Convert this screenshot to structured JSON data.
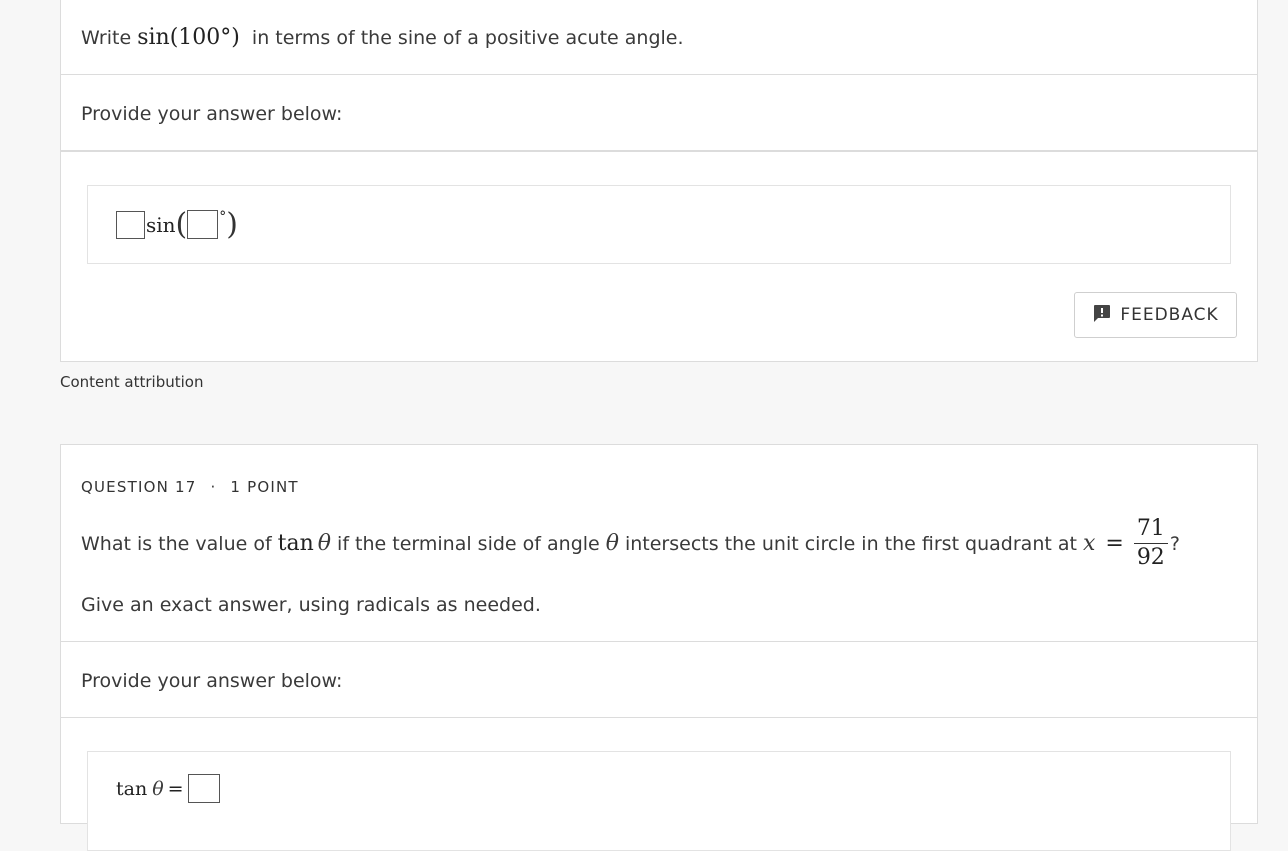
{
  "question16": {
    "prompt_prefix": "Write",
    "prompt_math": "sin(100°)",
    "prompt_suffix": "in terms of the sine of a positive acute angle.",
    "provide_label": "Provide your answer below:",
    "answer_template": {
      "func": "sin",
      "open_paren": "(",
      "degree": "°",
      "close_paren": ")"
    },
    "feedback_label": "FEEDBACK"
  },
  "attribution_label": "Content attribution",
  "question17": {
    "label": "QUESTION 17",
    "separator": "·",
    "points": "1 POINT",
    "prompt_part1": "What is the value of",
    "prompt_tan": "tan",
    "theta": "θ",
    "prompt_part2": "if the terminal side of angle",
    "prompt_part3": "intersects the unit circle in the first quadrant at",
    "x_var": "x",
    "equals": "=",
    "frac_num": "71",
    "frac_den": "92",
    "question_mark": "?",
    "instruction": "Give an exact answer, using radicals as needed.",
    "provide_label": "Provide your answer below:",
    "answer_tan": "tan",
    "answer_theta": "θ",
    "answer_equals": "="
  },
  "colors": {
    "page_bg": "#f7f7f7",
    "card_bg": "#ffffff",
    "border": "#dcdcdc",
    "text": "#3a3a3a"
  },
  "icons": {
    "feedback": "feedback-icon"
  }
}
